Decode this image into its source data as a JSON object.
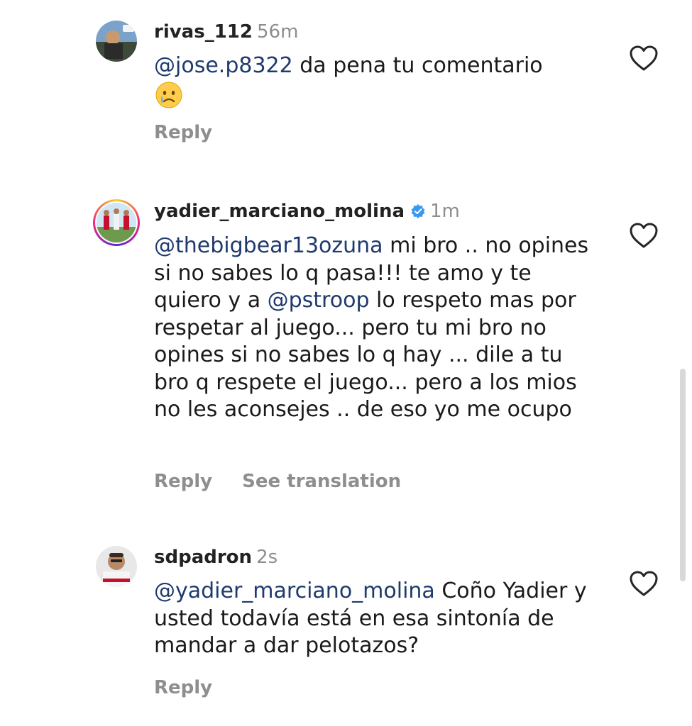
{
  "comments": [
    {
      "username": "rivas_112",
      "time": "56m",
      "mention": "@jose.p8322",
      "text": " da pena tu comentario",
      "emoji_icon": "crying-face-emoji",
      "reply_label": "Reply"
    },
    {
      "username": "yadier_marciano_molina",
      "time": "1m",
      "verified": true,
      "mention": "@thebigbear13ozuna",
      "text_1": " mi bro .. no opines si no sabes lo q pasa!!! te amo y te quiero y  a ",
      "mention_2": "@pstroop",
      "text_2": "  lo respeto mas por respetar al juego... pero tu mi bro no opines si no sabes lo q hay ... dile a tu  bro q respete el juego... pero a los mios no les aconsejes .. de eso yo me ocupo",
      "reply_label": "Reply",
      "translate_label": "See translation"
    },
    {
      "username": "sdpadron",
      "time": "2s",
      "mention": "@yadier_marciano_molina",
      "text": " Coño Yadier y usted todavía está en esa sintonía de mandar a dar pelotazos?",
      "reply_label": "Reply"
    }
  ],
  "colors": {
    "mention": "#1f3a6d",
    "muted": "#8e8e8e",
    "verified": "#3897f0"
  }
}
